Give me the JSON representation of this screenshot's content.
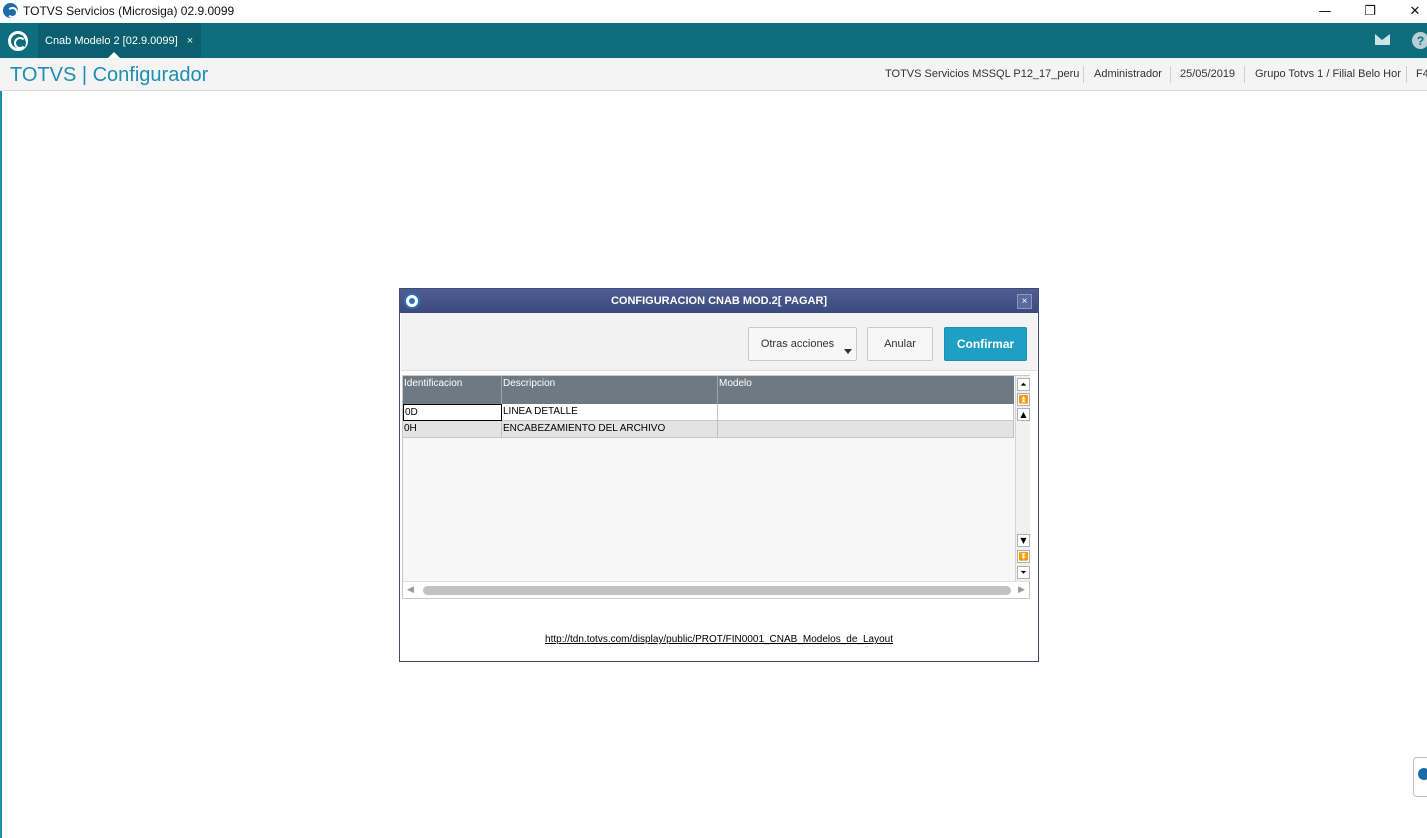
{
  "window": {
    "title": "TOTVS Servicios (Microsiga) 02.9.0099",
    "minimize_glyph": "—",
    "restore_glyph": "❐",
    "close_glyph": "✕"
  },
  "tabbar": {
    "active_tab": "Cnab Modelo 2 [02.9.0099]",
    "close_glyph": "×",
    "help_glyph": "?"
  },
  "header": {
    "app_title": "TOTVS | Configurador",
    "environment": "TOTVS Servicios MSSQL P12_17_peru",
    "user": "Administrador",
    "date": "25/05/2019",
    "company": "Grupo Totvs 1 / Filial Belo Hor",
    "shortcut": "F4"
  },
  "dialog": {
    "title": "CONFIGURACION CNAB MOD.2[ PAGAR]",
    "close_glyph": "×",
    "buttons": {
      "other_actions": "Otras acciones",
      "cancel": "Anular",
      "confirm": "Confirmar"
    },
    "grid": {
      "columns": [
        "Identificacion",
        "Descripcion",
        "Modelo"
      ],
      "rows": [
        [
          "0D",
          "LINEA DETALLE",
          ""
        ],
        [
          "0H",
          "ENCABEZAMIENTO DEL ARCHIVO",
          ""
        ]
      ]
    },
    "link": "http://tdn.totvs.com/display/public/PROT/FIN0001_CNAB_Modelos_de_Layout"
  },
  "icons": {
    "scroll_top": "⏶",
    "scroll_page_up": "⏫",
    "scroll_up": "▲",
    "scroll_down": "▼",
    "scroll_page_down": "⏬",
    "scroll_bottom": "⏷",
    "scroll_left": "◀",
    "scroll_right": "▶"
  },
  "colors": {
    "tabbar": "#0e6e7f",
    "title_accent": "#1d8fb3",
    "dialog_titlebar": "#3b4a7c",
    "confirm_button": "#1e9fc3",
    "grid_header": "#6e7a83"
  }
}
